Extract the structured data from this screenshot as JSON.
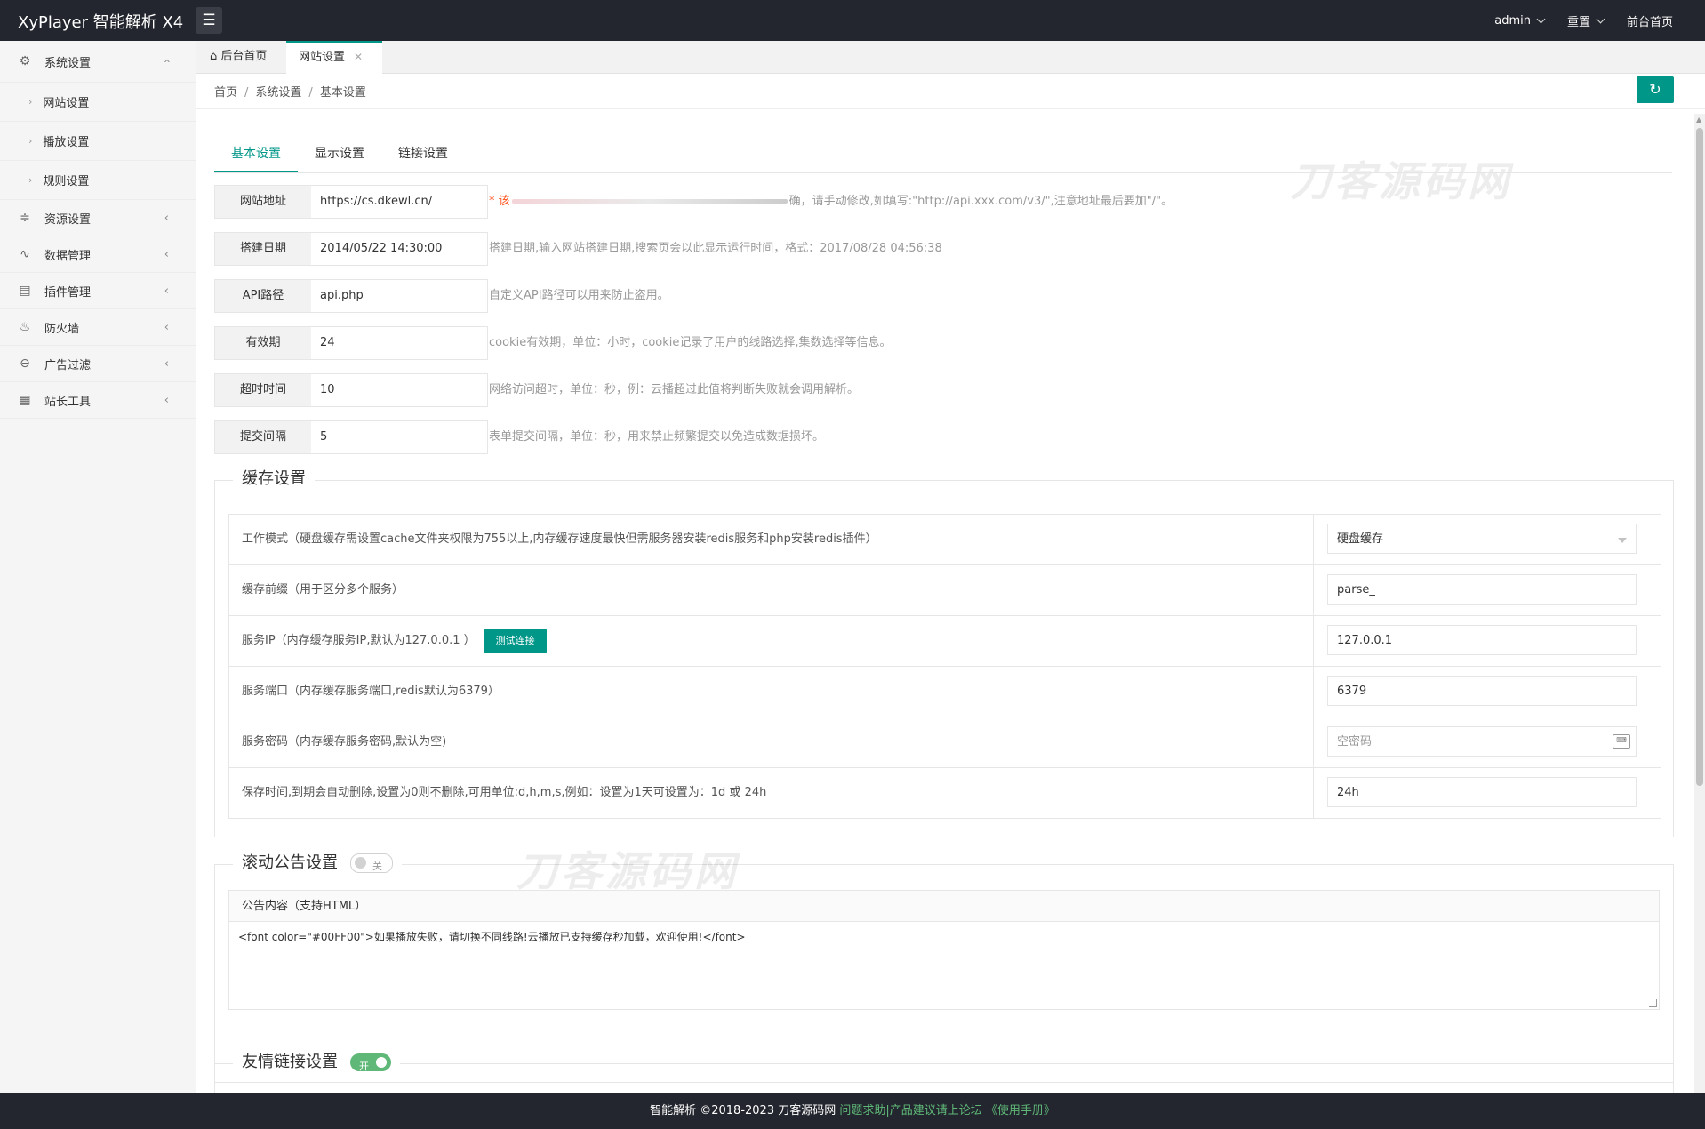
{
  "header": {
    "logo": "XyPlayer 智能解析 X4",
    "menu_icon": "menu-icon",
    "user": "admin",
    "reset": "重置",
    "front": "前台首页"
  },
  "sidebar": {
    "groups": [
      {
        "label": "系统设置",
        "icon": "gear-icon"
      },
      {
        "label": "资源设置",
        "icon": "rss-icon"
      },
      {
        "label": "数据管理",
        "icon": "pulse-icon"
      },
      {
        "label": "插件管理",
        "icon": "plugin-icon"
      },
      {
        "label": "防火墙",
        "icon": "fire-icon"
      },
      {
        "label": "广告过滤",
        "icon": "minus-circle-icon"
      },
      {
        "label": "站长工具",
        "icon": "apps-icon"
      }
    ],
    "subs": [
      "网站设置",
      "播放设置",
      "规则设置"
    ]
  },
  "tabs": {
    "home": "后台首页",
    "current": "网站设置"
  },
  "breadcrumb": {
    "a": "首页",
    "b": "系统设置",
    "c": "基本设置"
  },
  "settings_tabs": [
    "基本设置",
    "显示设置",
    "链接设置"
  ],
  "basic": {
    "rows": [
      {
        "label": "网站地址",
        "value": "https://cs.dkewl.cn/",
        "hint_prefix": "* 该",
        "hint": "确，请手动修改,如填写:\"http://api.xxx.com/v3/\",注意地址最后要加\"/\"。"
      },
      {
        "label": "搭建日期",
        "value": "2014/05/22 14:30:00",
        "hint": "搭建日期,输入网站搭建日期,搜索页会以此显示运行时间，格式：2017/08/28 04:56:38"
      },
      {
        "label": "API路径",
        "value": "api.php",
        "hint": "自定义API路径可以用来防止盗用。"
      },
      {
        "label": "有效期",
        "value": "24",
        "hint": "cookie有效期，单位：小时，cookie记录了用户的线路选择,集数选择等信息。"
      },
      {
        "label": "超时时间",
        "value": "10",
        "hint": "网络访问超时，单位：秒，例：云播超过此值将判断失败就会调用解析。"
      },
      {
        "label": "提交间隔",
        "value": "5",
        "hint": "表单提交间隔，单位：秒，用来禁止频繁提交以免造成数据损坏。"
      }
    ]
  },
  "cache": {
    "legend": "缓存设置",
    "test_button": "测试连接",
    "rows": [
      {
        "label": "工作模式（硬盘缓存需设置cache文件夹权限为755以上,内存缓存速度最快但需服务器安装redis服务和php安装redis插件）",
        "value": "硬盘缓存"
      },
      {
        "label": "缓存前缀（用于区分多个服务）",
        "value": "parse_"
      },
      {
        "label": "服务IP（内存缓存服务IP,默认为127.0.0.1 ）",
        "value": "127.0.0.1"
      },
      {
        "label": "服务端口（内存缓存服务端口,redis默认为6379）",
        "value": "6379"
      },
      {
        "label": "服务密码（内存缓存服务密码,默认为空)",
        "placeholder": "空密码"
      },
      {
        "label": "保存时间,到期会自动删除,设置为0则不删除,可用单位:d,h,m,s,例如：设置为1天可设置为：1d 或 24h",
        "value": "24h"
      }
    ]
  },
  "notice": {
    "legend": "滚动公告设置",
    "switch_label": "关",
    "enabled": false,
    "head": "公告内容（支持HTML）",
    "content": "<font color=\"#00FF00\">如果播放失败，请切换不同线路!云播放已支持缓存秒加载，欢迎使用!</font>"
  },
  "links": {
    "legend": "友情链接设置",
    "switch_label": "开",
    "enabled": true
  },
  "watermark": "刀客源码网",
  "footer": {
    "text": "智能解析 ©2018-2023 刀客源码网",
    "link_text": "问题求助|产品建议请上论坛 《使用手册》"
  },
  "colors": {
    "accent": "#009688",
    "switch_on": "#5fb878",
    "header": "#23262e"
  }
}
